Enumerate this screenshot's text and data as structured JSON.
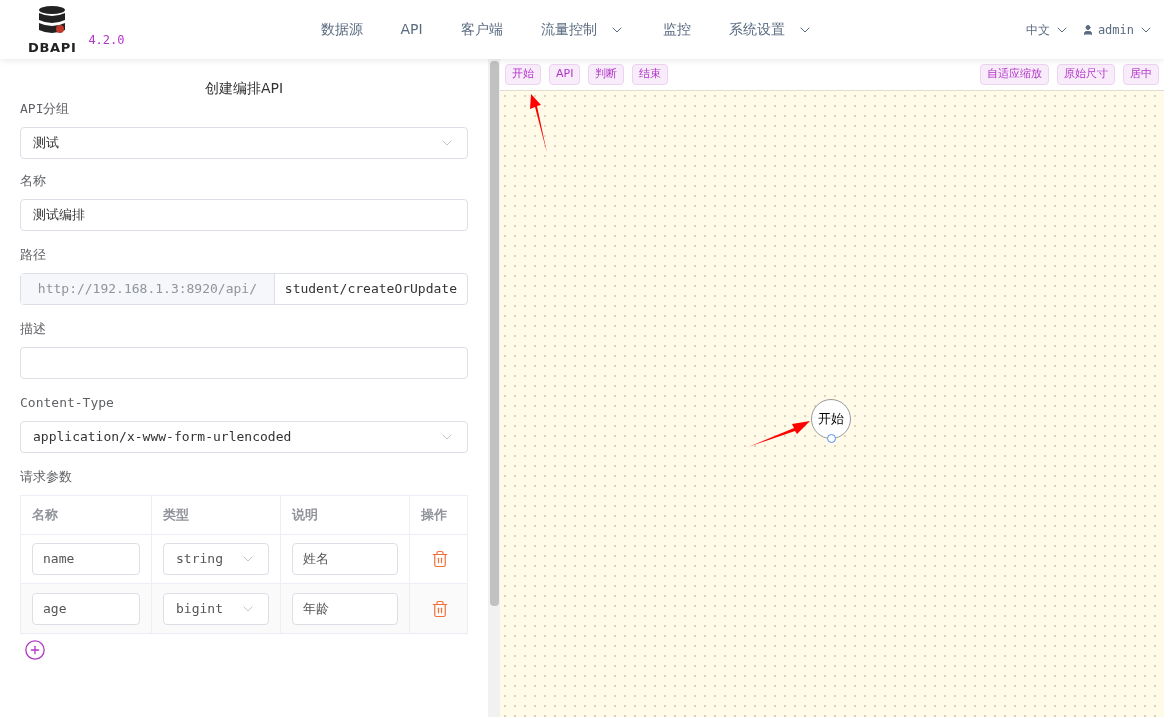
{
  "header": {
    "logo_text": "DBAPI",
    "version": "4.2.0",
    "nav": [
      {
        "label": "数据源",
        "dropdown": false
      },
      {
        "label": "API",
        "dropdown": false
      },
      {
        "label": "客户端",
        "dropdown": false
      },
      {
        "label": "流量控制",
        "dropdown": true
      },
      {
        "label": "监控",
        "dropdown": false
      },
      {
        "label": "系统设置",
        "dropdown": true
      }
    ],
    "language": "中文",
    "user": "admin"
  },
  "form": {
    "title": "创建编排API",
    "group": {
      "label": "API分组",
      "value": "测试"
    },
    "name": {
      "label": "名称",
      "value": "测试编排"
    },
    "path": {
      "label": "路径",
      "prefix": "http://192.168.1.3:8920/api/",
      "value": "student/createOrUpdate"
    },
    "description": {
      "label": "描述"
    },
    "content_type": {
      "label": "Content-Type",
      "value": "application/x-www-form-urlencoded"
    },
    "params": {
      "label": "请求参数",
      "columns": [
        "名称",
        "类型",
        "说明",
        "操作"
      ],
      "rows": [
        {
          "name": "name",
          "type": "string",
          "description": "姓名"
        },
        {
          "name": "age",
          "type": "bigint",
          "description": "年龄"
        }
      ]
    }
  },
  "canvas": {
    "toolbar_left": [
      "开始",
      "API",
      "判断",
      "结束"
    ],
    "toolbar_right": [
      "自适应缩放",
      "原始尺寸",
      "居中"
    ],
    "nodes": [
      {
        "label": "开始",
        "kind": "start"
      }
    ]
  }
}
